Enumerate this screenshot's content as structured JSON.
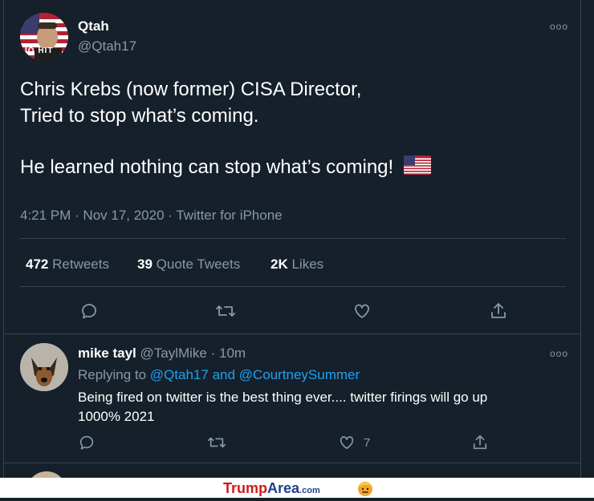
{
  "tweet": {
    "display_name": "Qtah",
    "handle": "@Qtah17",
    "avatar_label": "IQ HIT",
    "line1": "Chris Krebs (now former) CISA Director,",
    "line2": "Tried to stop what’s coming.",
    "line3": "He learned nothing can stop what’s coming!",
    "meta": "4:21 PM · Nov 17, 2020 · Twitter for iPhone",
    "stats": [
      {
        "count": "472",
        "label": "Retweets"
      },
      {
        "count": "39",
        "label": "Quote Tweets"
      },
      {
        "count": "2K",
        "label": "Likes"
      }
    ],
    "more_icon": "ooo"
  },
  "reply": {
    "display_name": "mike tayl",
    "handle": "@TaylMike",
    "time": "· 10m",
    "replying_prefix": "Replying to",
    "mention1": "@Qtah17",
    "and": "and",
    "mention2": "@CourtneySummer",
    "text_line1": "Being fired on twitter is the best thing ever.... twitter firings will go up",
    "text_line2": "1000% 2021",
    "like_count": "7",
    "more_icon": "ooo"
  },
  "footer": {
    "brand_part1": "Trump",
    "brand_part2": "Area",
    "brand_tld": ".com"
  },
  "colors": {
    "background": "#15202b",
    "border": "#38444d",
    "muted": "#8899a6",
    "link": "#1da1f2"
  }
}
